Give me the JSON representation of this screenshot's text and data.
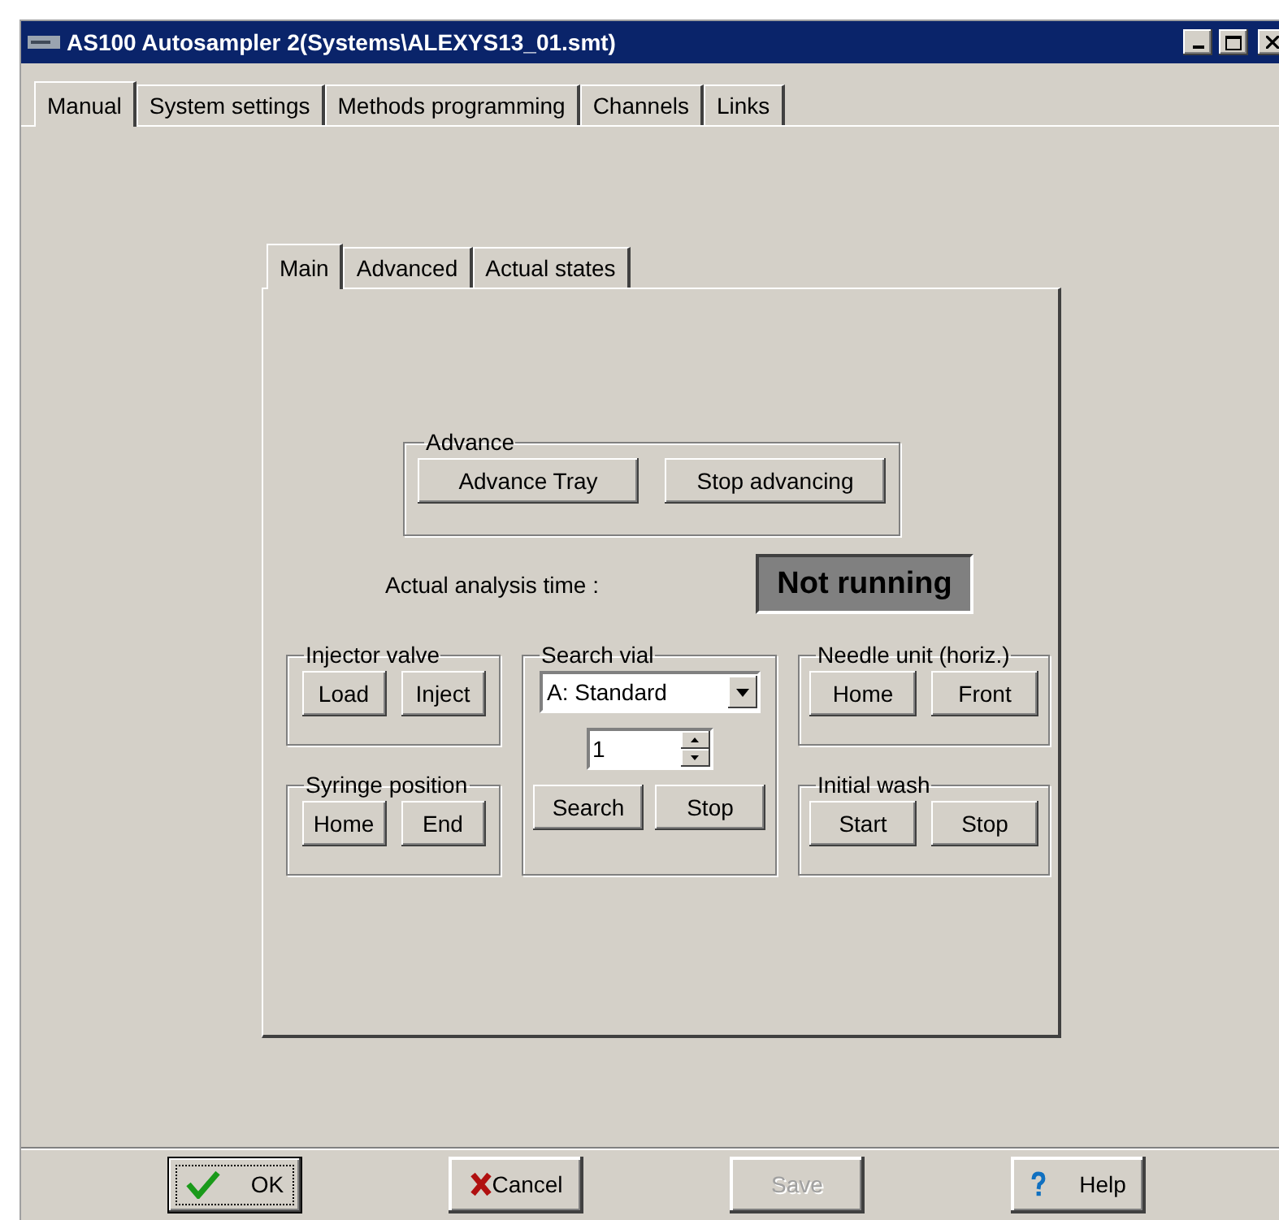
{
  "window": {
    "title": "AS100 Autosampler 2(Systems\\ALEXYS13_01.smt)"
  },
  "tabs": [
    {
      "label": "Manual",
      "selected": true
    },
    {
      "label": "System settings",
      "selected": false
    },
    {
      "label": "Methods programming",
      "selected": false
    },
    {
      "label": "Channels",
      "selected": false
    },
    {
      "label": "Links",
      "selected": false
    }
  ],
  "inner_tabs": [
    {
      "label": "Main",
      "selected": true
    },
    {
      "label": "Advanced",
      "selected": false
    },
    {
      "label": "Actual states",
      "selected": false
    }
  ],
  "advance": {
    "title": "Advance",
    "buttons": [
      "Advance Tray",
      "Stop advancing"
    ]
  },
  "analysis_time": {
    "label": "Actual analysis time :",
    "value": "Not running"
  },
  "group_columns": [
    [
      {
        "title": "Injector valve",
        "buttons": [
          "Load",
          "Inject"
        ]
      },
      {
        "title": "Syringe position",
        "buttons": [
          "Home",
          "End"
        ]
      }
    ],
    [
      {
        "title": "Search vial",
        "dropdown": "A: Standard",
        "spinner": "1",
        "buttons": [
          "Search",
          "Stop"
        ]
      }
    ],
    [
      {
        "title": "Needle unit (horiz.)",
        "buttons": [
          "Home",
          "Front"
        ]
      },
      {
        "title": "Initial wash",
        "buttons": [
          "Start",
          "Stop"
        ]
      }
    ]
  ],
  "dialog_buttons": [
    {
      "kind": "ok",
      "label": "OK",
      "disabled": false,
      "default": true
    },
    {
      "kind": "cancel",
      "label": "Cancel",
      "disabled": false,
      "default": false
    },
    {
      "kind": "save",
      "label": "Save",
      "disabled": true,
      "default": false
    },
    {
      "kind": "help",
      "label": "Help",
      "disabled": false,
      "default": false
    }
  ]
}
